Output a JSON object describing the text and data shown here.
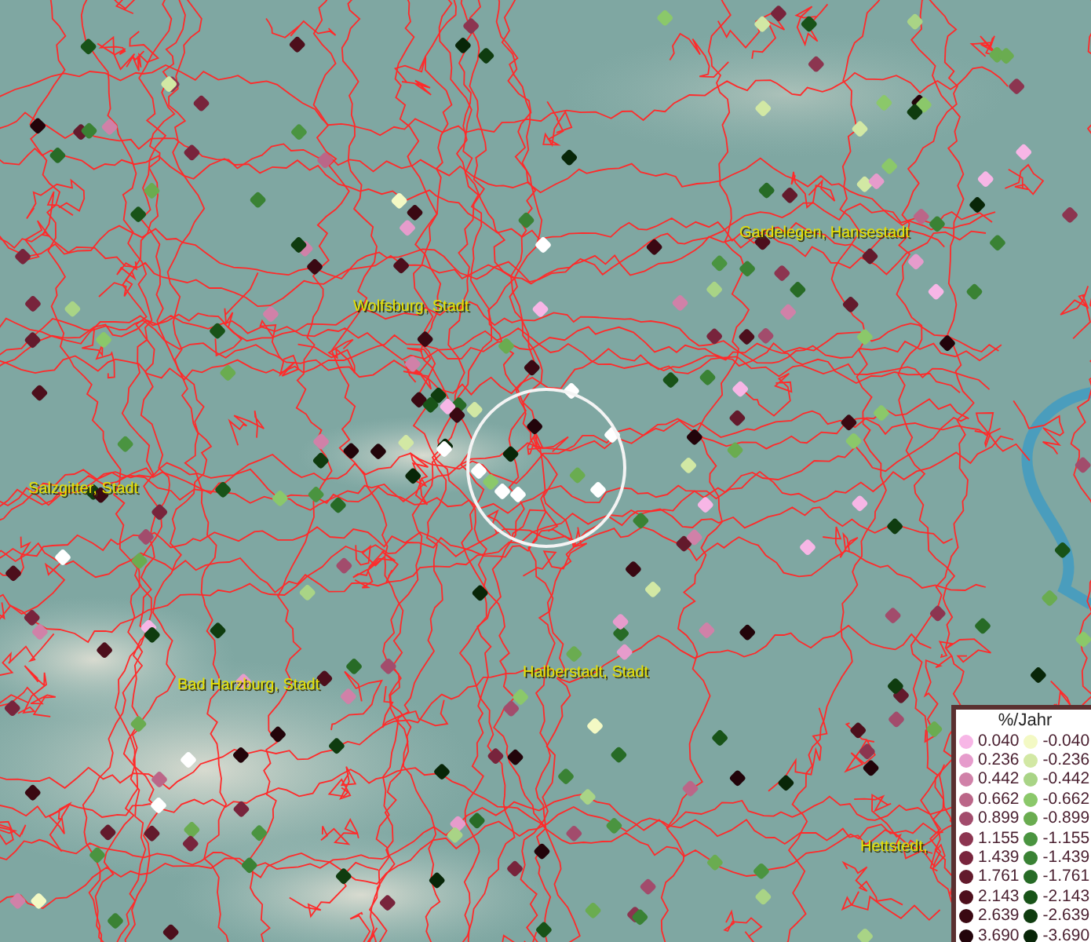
{
  "map": {
    "places": [
      {
        "name": "Gardelegen, Hansestadt"
      },
      {
        "name": "Wolfsburg, Stadt"
      },
      {
        "name": "Salzgitter, Stadt"
      },
      {
        "name": "Bad Harzburg, Stadt"
      },
      {
        "name": "Halberstadt, Stadt"
      },
      {
        "name": "Hettstedt,"
      }
    ]
  },
  "legend": {
    "title": "%/Jahr",
    "positive": [
      {
        "label": "0.040",
        "color": "#f7b6e6"
      },
      {
        "label": "0.236",
        "color": "#e69ccc"
      },
      {
        "label": "0.442",
        "color": "#d081a8"
      },
      {
        "label": "0.662",
        "color": "#bb6688"
      },
      {
        "label": "0.899",
        "color": "#a24c6c"
      },
      {
        "label": "1.155",
        "color": "#8c3550"
      },
      {
        "label": "1.439",
        "color": "#78243c"
      },
      {
        "label": "1.761",
        "color": "#631a2c"
      },
      {
        "label": "2.143",
        "color": "#4d0f1c"
      },
      {
        "label": "2.639",
        "color": "#3a0812"
      },
      {
        "label": "3.690",
        "color": "#22040a"
      }
    ],
    "negative": [
      {
        "label": "-0.040",
        "color": "#f3f9c4"
      },
      {
        "label": "-0.236",
        "color": "#d2e8a4"
      },
      {
        "label": "-0.442",
        "color": "#a9d486"
      },
      {
        "label": "-0.662",
        "color": "#8bc86a"
      },
      {
        "label": "-0.899",
        "color": "#6aac50"
      },
      {
        "label": "-1.155",
        "color": "#4a9440"
      },
      {
        "label": "-1.439",
        "color": "#3a8234"
      },
      {
        "label": "-1.761",
        "color": "#276b26"
      },
      {
        "label": "-2.143",
        "color": "#185318"
      },
      {
        "label": "-2.639",
        "color": "#0f3c0f"
      },
      {
        "label": "-3.690",
        "color": "#082608"
      }
    ]
  }
}
